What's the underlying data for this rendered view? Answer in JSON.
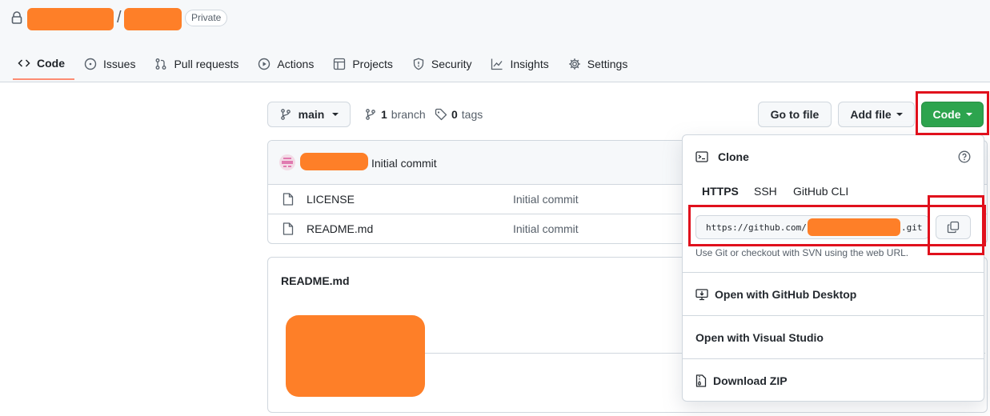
{
  "repo": {
    "separator": "/",
    "visibility": "Private"
  },
  "tabs": [
    {
      "label": "Code",
      "icon": "code-icon"
    },
    {
      "label": "Issues",
      "icon": "issue-opened-icon"
    },
    {
      "label": "Pull requests",
      "icon": "git-pull-request-icon"
    },
    {
      "label": "Actions",
      "icon": "play-icon"
    },
    {
      "label": "Projects",
      "icon": "table-icon"
    },
    {
      "label": "Security",
      "icon": "shield-icon"
    },
    {
      "label": "Insights",
      "icon": "graph-icon"
    },
    {
      "label": "Settings",
      "icon": "gear-icon"
    }
  ],
  "branch_bar": {
    "branch_name": "main",
    "branch_count": "1",
    "branch_word": "branch",
    "tag_count": "0",
    "tag_word": "tags",
    "go_to_file": "Go to file",
    "add_file": "Add file",
    "code_button": "Code"
  },
  "files": {
    "commit_message": "Initial commit",
    "rows": [
      {
        "name": "LICENSE",
        "message": "Initial commit"
      },
      {
        "name": "README.md",
        "message": "Initial commit"
      }
    ]
  },
  "readme": {
    "title": "README.md"
  },
  "clone_panel": {
    "title": "Clone",
    "tabs": [
      "HTTPS",
      "SSH",
      "GitHub CLI"
    ],
    "selected_tab": "HTTPS",
    "url_prefix": "https://github.com/",
    "url_suffix": ".git",
    "hint": "Use Git or checkout with SVN using the web URL.",
    "open_desktop": "Open with GitHub Desktop",
    "open_vs": "Open with Visual Studio",
    "download_zip": "Download ZIP"
  },
  "colors": {
    "primary_green": "#2da44e",
    "highlight_red": "#e0101c",
    "redaction_orange": "#fe7f28",
    "tab_underline": "#fd8c73"
  }
}
